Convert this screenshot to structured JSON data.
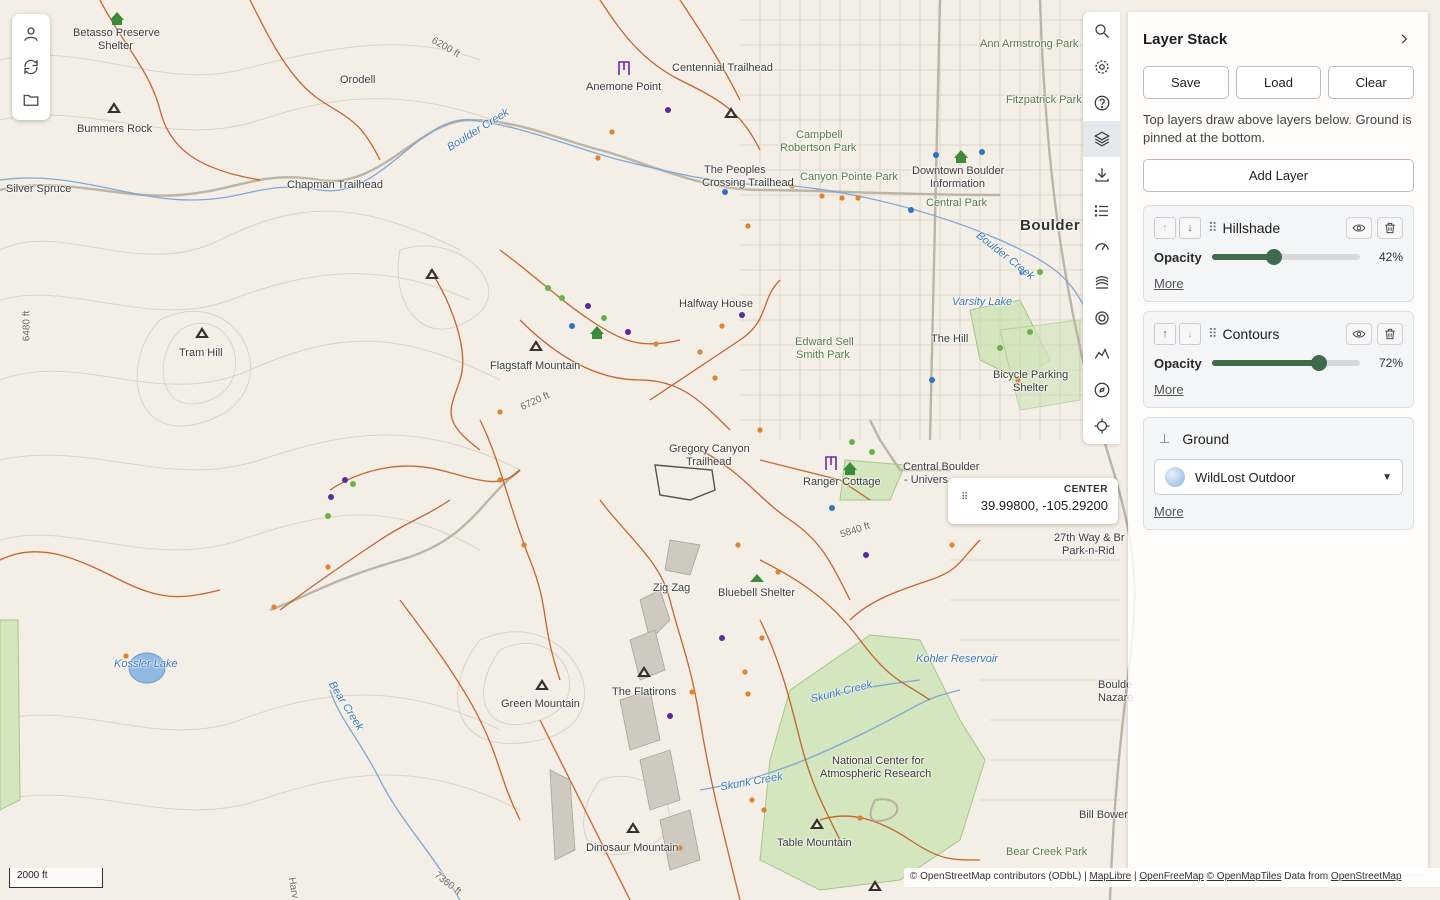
{
  "map": {
    "labels": [
      {
        "text": "Betasso Preserve",
        "kind": "normal"
      },
      {
        "text": "Shelter",
        "kind": "normal"
      },
      {
        "text": "Bummers Rock",
        "kind": "normal"
      },
      {
        "text": "Silver Spruce",
        "kind": "normal"
      },
      {
        "text": "Chapman Trailhead",
        "kind": "normal"
      },
      {
        "text": "Orodell",
        "kind": "normal"
      },
      {
        "text": "6200 ft",
        "kind": "contour"
      },
      {
        "text": "Boulder Creek",
        "kind": "blue"
      },
      {
        "text": "Anemone Point",
        "kind": "normal"
      },
      {
        "text": "Centennial Trailhead",
        "kind": "normal"
      },
      {
        "text": "Ann Armstrong Park",
        "kind": "green"
      },
      {
        "text": "Fitzpatrick Park",
        "kind": "green"
      },
      {
        "text": "Campbell",
        "kind": "green"
      },
      {
        "text": "Robertson Park",
        "kind": "green"
      },
      {
        "text": "The Peoples",
        "kind": "normal"
      },
      {
        "text": "Crossing Trailhead",
        "kind": "normal"
      },
      {
        "text": "Canyon Pointe Park",
        "kind": "green"
      },
      {
        "text": "Downtown Boulder",
        "kind": "normal"
      },
      {
        "text": "Information",
        "kind": "normal"
      },
      {
        "text": "Central Park",
        "kind": "green"
      },
      {
        "text": "Boulder",
        "kind": "big"
      },
      {
        "text": "Boulder Creek",
        "kind": "blue"
      },
      {
        "text": "Varsity Lake",
        "kind": "blue"
      },
      {
        "text": "Tram Hill",
        "kind": "normal"
      },
      {
        "text": "Flagstaff Mountain",
        "kind": "normal"
      },
      {
        "text": "Halfway House",
        "kind": "normal"
      },
      {
        "text": "Edward Sell",
        "kind": "green"
      },
      {
        "text": "Smith Park",
        "kind": "green"
      },
      {
        "text": "The Hill",
        "kind": "normal"
      },
      {
        "text": "Bicycle Parking",
        "kind": "normal"
      },
      {
        "text": "Shelter",
        "kind": "normal"
      },
      {
        "text": "6720 ft",
        "kind": "contour"
      },
      {
        "text": "Gregory Canyon",
        "kind": "normal"
      },
      {
        "text": "Trailhead",
        "kind": "normal"
      },
      {
        "text": "Ranger Cottage",
        "kind": "normal"
      },
      {
        "text": "Central Boulder",
        "kind": "normal"
      },
      {
        "text": "- Univers",
        "kind": "normal"
      },
      {
        "text": "5840 ft",
        "kind": "contour"
      },
      {
        "text": "27th Way & Br",
        "kind": "normal"
      },
      {
        "text": "Park-n-Rid",
        "kind": "normal"
      },
      {
        "text": "Zig Zag",
        "kind": "normal"
      },
      {
        "text": "Bluebell Shelter",
        "kind": "normal"
      },
      {
        "text": "Kossler Lake",
        "kind": "blue"
      },
      {
        "text": "Kohler Reservoir",
        "kind": "blue"
      },
      {
        "text": "Skunk Creek",
        "kind": "blue"
      },
      {
        "text": "The Flatirons",
        "kind": "normal"
      },
      {
        "text": "Green Mountain",
        "kind": "normal"
      },
      {
        "text": "Bear Creek",
        "kind": "blue"
      },
      {
        "text": "National Center for",
        "kind": "normal"
      },
      {
        "text": "Atmospheric Research",
        "kind": "normal"
      },
      {
        "text": "Skunk Creek",
        "kind": "blue"
      },
      {
        "text": "Boulde",
        "kind": "normal"
      },
      {
        "text": "Nazare",
        "kind": "normal"
      },
      {
        "text": "Bill Bower",
        "kind": "normal"
      },
      {
        "text": "Table Mountain",
        "kind": "normal"
      },
      {
        "text": "Dinosaur Mountain",
        "kind": "normal"
      },
      {
        "text": "Bear Creek Park",
        "kind": "green"
      },
      {
        "text": "7360 ft",
        "kind": "contour"
      },
      {
        "text": "6480 ft",
        "kind": "contour"
      },
      {
        "text": "Harv",
        "kind": "contour"
      }
    ]
  },
  "left_toolbar": {
    "icons": [
      "user-icon",
      "refresh-icon",
      "folder-icon"
    ]
  },
  "rail": {
    "icons": [
      "search-icon",
      "gear-icon",
      "help-icon",
      "layers-icon",
      "download-icon",
      "list-icon",
      "gauge-icon",
      "terrain-icon",
      "target-icon",
      "elevation-icon",
      "compass-icon",
      "locate-icon"
    ],
    "active": "layers-icon"
  },
  "panel": {
    "title": "Layer Stack",
    "save_label": "Save",
    "load_label": "Load",
    "clear_label": "Clear",
    "hint": "Top layers draw above layers below. Ground is pinned at the bottom.",
    "add_layer_label": "Add Layer",
    "layers": [
      {
        "name": "Hillshade",
        "opacity_label": "Opacity",
        "opacity": 42,
        "opacity_text": "42%",
        "more": "More",
        "up_disabled": true,
        "down_disabled": false
      },
      {
        "name": "Contours",
        "opacity_label": "Opacity",
        "opacity": 72,
        "opacity_text": "72%",
        "more": "More",
        "up_disabled": false,
        "down_disabled": true
      }
    ],
    "ground": {
      "name": "Ground",
      "selected": "WildLost Outdoor",
      "more": "More"
    }
  },
  "center": {
    "label": "CENTER",
    "value": "39.99800, -105.29200"
  },
  "scale": {
    "label": "2000 ft"
  },
  "attribution": {
    "osm": "© OpenStreetMap contributors (ODbL)",
    "sep1": "|",
    "maplibre": "MapLibre",
    "sep2": "|",
    "openfreemap": "OpenFreeMap",
    "omt": "© OpenMapTiles",
    "data_from": "Data from",
    "osm2": "OpenStreetMap"
  },
  "colors": {
    "trail": "#c2571c",
    "park": "#cfe3b8",
    "water": "#8fb8e3",
    "road": "#c8c0b4",
    "accent": "#3f6b4a"
  }
}
